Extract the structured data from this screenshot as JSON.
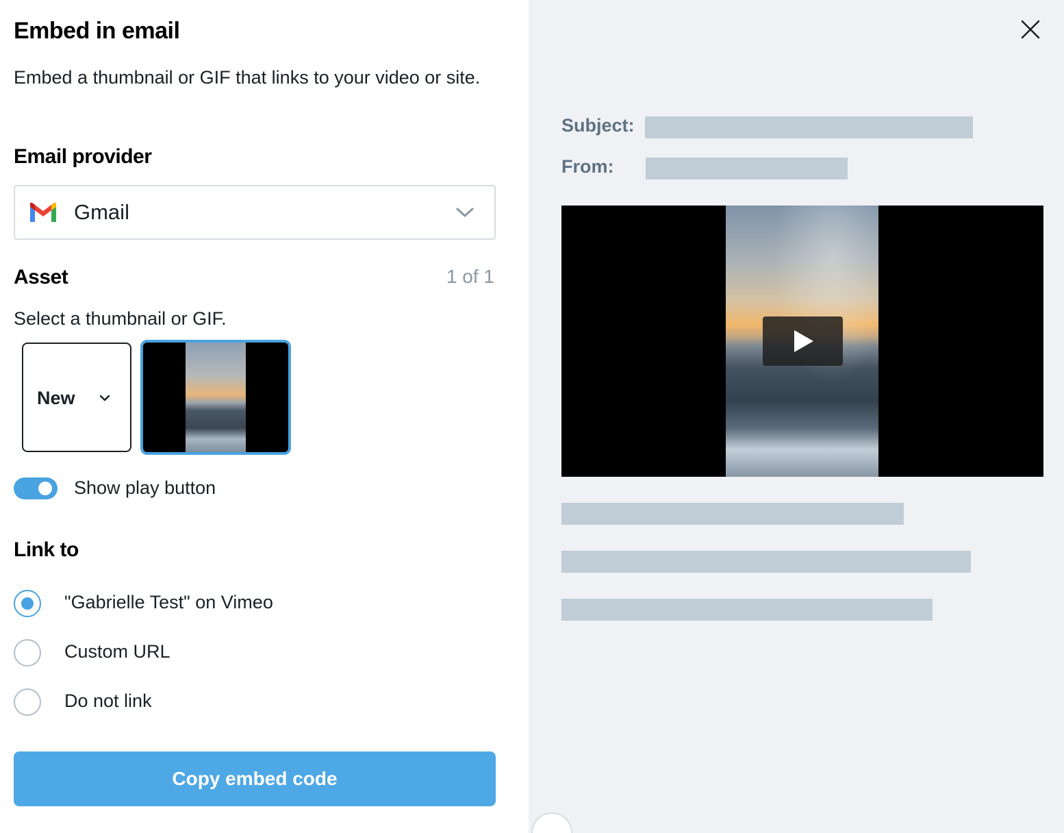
{
  "panel": {
    "title": "Embed in email",
    "description": "Embed a thumbnail or GIF that links to your video or site."
  },
  "email_provider": {
    "label": "Email provider",
    "selected": "Gmail",
    "icon": "gmail-icon"
  },
  "asset": {
    "label": "Asset",
    "count": "1 of 1",
    "hint": "Select a thumbnail or GIF.",
    "new_tile_label": "New"
  },
  "play_toggle": {
    "label": "Show play button",
    "on": true
  },
  "link_to": {
    "label": "Link to",
    "options": [
      {
        "label": "\"Gabrielle Test\" on Vimeo",
        "checked": true
      },
      {
        "label": "Custom URL",
        "checked": false
      },
      {
        "label": "Do not link",
        "checked": false
      }
    ]
  },
  "copy_button": {
    "label": "Copy embed code"
  },
  "preview": {
    "subject_label": "Subject:",
    "from_label": "From:"
  },
  "colors": {
    "accent": "#48a3e0",
    "button": "#4ea8e5",
    "preview_bg": "#eff1f5",
    "placeholder": "#c0ccd6"
  }
}
